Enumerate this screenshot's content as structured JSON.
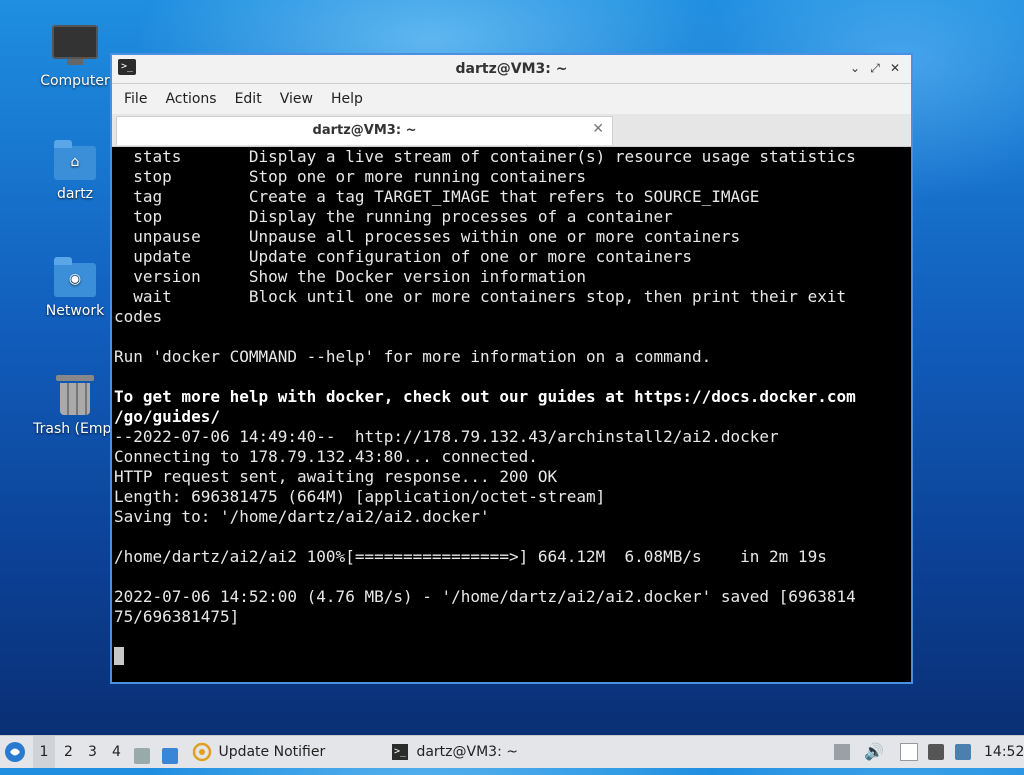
{
  "desktop": {
    "icons": [
      {
        "label": "Computer"
      },
      {
        "label": "dartz"
      },
      {
        "label": "Network"
      },
      {
        "label": "Trash (Empt"
      }
    ]
  },
  "window": {
    "title": "dartz@VM3: ~",
    "menu": [
      "File",
      "Actions",
      "Edit",
      "View",
      "Help"
    ],
    "tab_title": "dartz@VM3: ~",
    "controls": {
      "minimize": "⌄",
      "maximize": "⤢",
      "close": "✕"
    }
  },
  "terminal": {
    "lines": [
      "  stats       Display a live stream of container(s) resource usage statistics",
      "  stop        Stop one or more running containers",
      "  tag         Create a tag TARGET_IMAGE that refers to SOURCE_IMAGE",
      "  top         Display the running processes of a container",
      "  unpause     Unpause all processes within one or more containers",
      "  update      Update configuration of one or more containers",
      "  version     Show the Docker version information",
      "  wait        Block until one or more containers stop, then print their exit",
      "codes",
      "",
      "Run 'docker COMMAND --help' for more information on a command.",
      ""
    ],
    "bold_lines": [
      "To get more help with docker, check out our guides at https://docs.docker.com",
      "/go/guides/"
    ],
    "lines2": [
      "--2022-07-06 14:49:40--  http://178.79.132.43/archinstall2/ai2.docker",
      "Connecting to 178.79.132.43:80... connected.",
      "HTTP request sent, awaiting response... 200 OK",
      "Length: 696381475 (664M) [application/octet-stream]",
      "Saving to: '/home/dartz/ai2/ai2.docker'",
      "",
      "/home/dartz/ai2/ai2 100%[================>] 664.12M  6.08MB/s    in 2m 19s",
      "",
      "2022-07-06 14:52:00 (4.76 MB/s) - '/home/dartz/ai2/ai2.docker' saved [6963814",
      "75/696381475]",
      "",
      ""
    ]
  },
  "taskbar": {
    "workspaces": [
      "1",
      "2",
      "3",
      "4"
    ],
    "active_workspace": "1",
    "apps": [
      {
        "label": "Update Notifier"
      },
      {
        "label": "dartz@VM3: ~"
      }
    ],
    "clock": "14:52"
  }
}
